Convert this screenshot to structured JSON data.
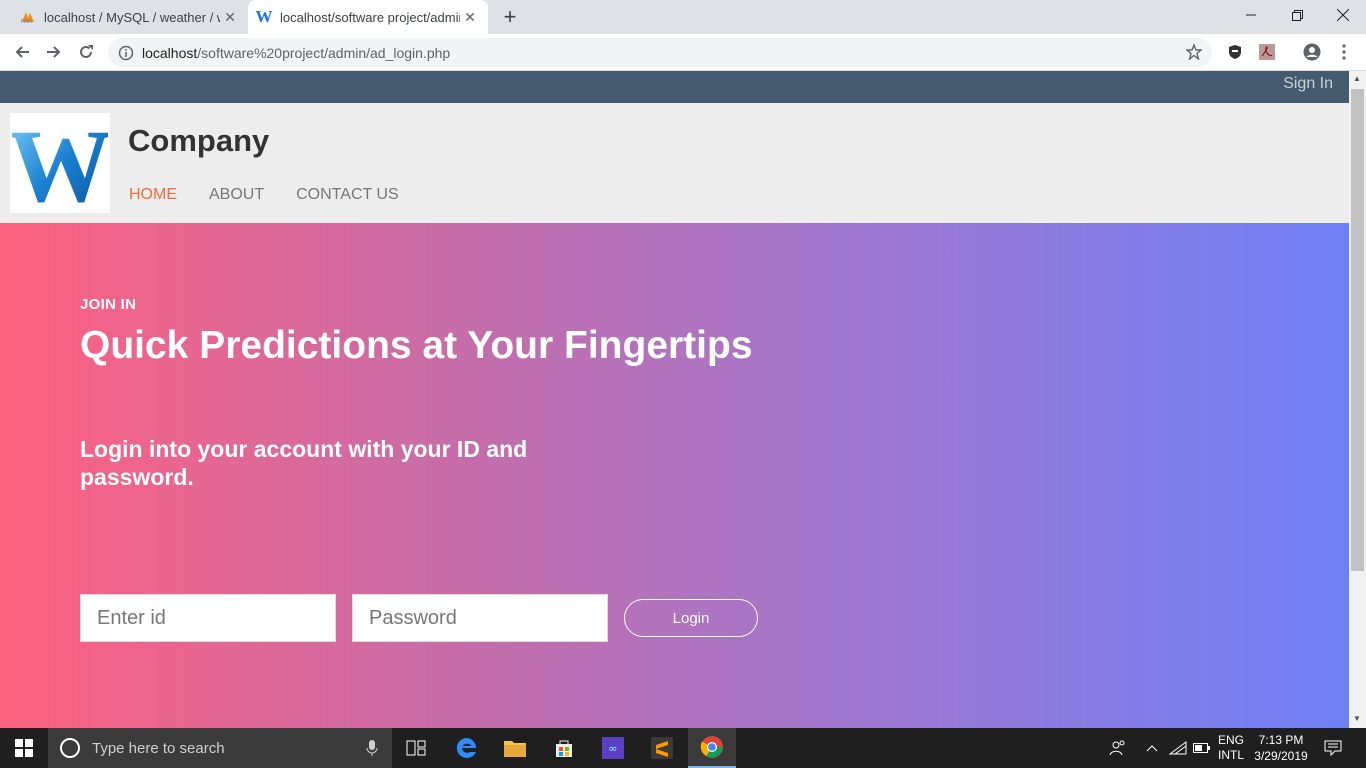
{
  "browser": {
    "tabs": [
      {
        "title": "localhost / MySQL / weather / wc",
        "active": false
      },
      {
        "title": "localhost/software project/admin",
        "active": true
      }
    ],
    "url_host": "localhost",
    "url_path": "/software%20project/admin/ad_login.php"
  },
  "site": {
    "signin_label": "Sign In",
    "company": "Company",
    "logo_letter": "W",
    "nav": [
      "HOME",
      "ABOUT",
      "CONTACT US"
    ],
    "hero": {
      "eyebrow": "JOIN IN",
      "headline": "Quick Predictions at Your Fingertips",
      "subtitle": "Login into your account with your ID and password.",
      "id_placeholder": "Enter id",
      "password_placeholder": "Password",
      "login_label": "Login"
    }
  },
  "taskbar": {
    "search_placeholder": "Type here to search",
    "lang_top": "ENG",
    "lang_bottom": "INTL",
    "time": "7:13 PM",
    "date": "3/29/2019"
  },
  "colors": {
    "topbar": "#455a6e",
    "nav_active": "#f26b3a",
    "gradient_start": "#fe617f",
    "gradient_end": "#6f80f7"
  }
}
